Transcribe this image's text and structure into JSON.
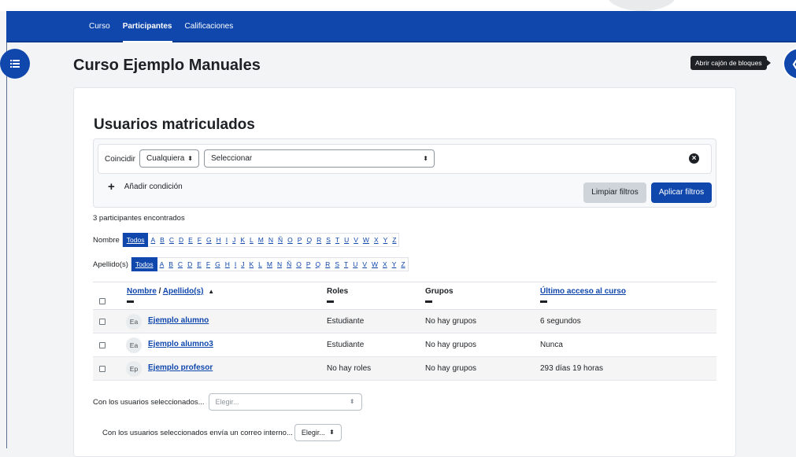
{
  "nav": {
    "tabs": [
      {
        "label": "Curso"
      },
      {
        "label": "Participantes",
        "active": true
      },
      {
        "label": "Calificaciones"
      }
    ]
  },
  "page": {
    "course_title": "Curso Ejemplo Manuales",
    "section_title": "Usuarios matriculados",
    "tooltip": "Abrir cajón de bloques"
  },
  "filter": {
    "match_label": "Coincidir",
    "match_value": "Cualquiera",
    "select_value": "Seleccionar",
    "add_condition": "Añadir condición",
    "clear_label": "Limpiar filtros",
    "apply_label": "Aplicar filtros"
  },
  "count_text": "3 participantes encontrados",
  "initials": {
    "first_label": "Nombre",
    "last_label": "Apellido(s)",
    "all": "Todos",
    "letters": [
      "A",
      "B",
      "C",
      "D",
      "E",
      "F",
      "G",
      "H",
      "I",
      "J",
      "K",
      "L",
      "M",
      "N",
      "Ñ",
      "O",
      "P",
      "Q",
      "R",
      "S",
      "T",
      "U",
      "V",
      "W",
      "X",
      "Y",
      "Z"
    ]
  },
  "table": {
    "headers": {
      "name_first": "Nombre",
      "separator": " / ",
      "name_last": "Apellido(s)",
      "sort_icon": "▲",
      "roles": "Roles",
      "groups": "Grupos",
      "last_access": "Último acceso al curso"
    },
    "rows": [
      {
        "initials": "Ea",
        "name": "Ejemplo alumno",
        "role": "Estudiante",
        "groups": "No hay grupos",
        "last_access": "6 segundos"
      },
      {
        "initials": "Ea",
        "name": "Ejemplo alumno3",
        "role": "Estudiante",
        "groups": "No hay grupos",
        "last_access": "Nunca"
      },
      {
        "initials": "Ep",
        "name": "Ejemplo profesor",
        "role": "No hay roles",
        "groups": "No hay grupos",
        "last_access": "293 días 19 horas"
      }
    ]
  },
  "bulk": {
    "with_selected": "Con los usuarios seleccionados...",
    "with_selected_placeholder": "Elegir...",
    "send_message": "Con los usuarios seleccionados envía un correo interno...",
    "send_message_placeholder": "Elegir..."
  },
  "colors": {
    "brand": "#0f47ad",
    "text": "#1d2125"
  }
}
